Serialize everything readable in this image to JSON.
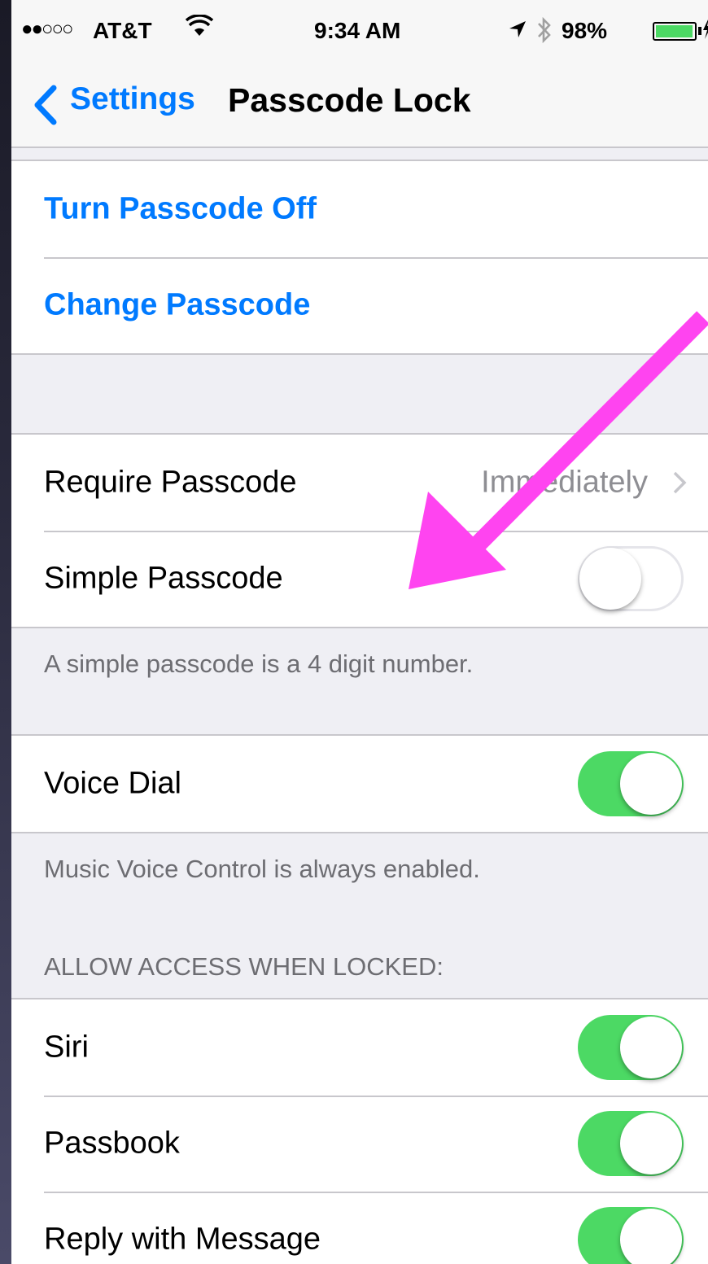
{
  "status_bar": {
    "signal": "●●○○○",
    "carrier": "AT&T",
    "wifi_icon": "wifi-icon",
    "time": "9:34 AM",
    "location_icon": "location-arrow-icon",
    "bluetooth_icon": "bluetooth-icon",
    "battery_percent": "98%",
    "battery_level": 0.98,
    "battery_color": "#4cd964"
  },
  "nav": {
    "back_label": "Settings",
    "title": "Passcode Lock"
  },
  "group_passcode": {
    "turn_off": "Turn Passcode Off",
    "change": "Change Passcode"
  },
  "group_require": {
    "require_label": "Require Passcode",
    "require_value": "Immediately",
    "simple_label": "Simple Passcode",
    "simple_on": false,
    "simple_note": "A simple passcode is a 4 digit number."
  },
  "group_voice": {
    "voice_dial_label": "Voice Dial",
    "voice_dial_on": true,
    "voice_note": "Music Voice Control is always enabled."
  },
  "group_access": {
    "header": "ALLOW ACCESS WHEN LOCKED:",
    "items": [
      {
        "label": "Siri",
        "on": true
      },
      {
        "label": "Passbook",
        "on": true
      },
      {
        "label": "Reply with Message",
        "on": true
      }
    ]
  },
  "colors": {
    "tint": "#007aff",
    "switch_on": "#4cd964",
    "annotation": "#ff44f0"
  }
}
